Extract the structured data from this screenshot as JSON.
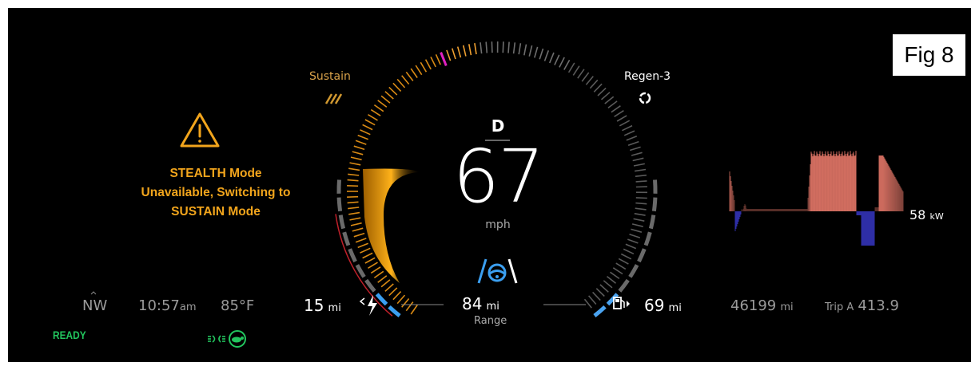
{
  "figure_label": "Fig 8",
  "mode_left": {
    "label": "Sustain"
  },
  "mode_right": {
    "label": "Regen-3"
  },
  "warning": {
    "line1": "STEALTH Mode",
    "line2": "Unavailable, Switching to",
    "line3": "SUSTAIN Mode"
  },
  "gear": "D",
  "speed": {
    "value": "67",
    "unit": "mph"
  },
  "power": {
    "value": "58",
    "unit": "kW"
  },
  "bottom": {
    "heading": "NW",
    "time": "10:57",
    "time_suffix": "am",
    "temperature": "85°F",
    "electric_range": "15",
    "electric_unit": "mi",
    "total_range": "84",
    "total_unit": "mi",
    "range_label": "Range",
    "fuel_range": "69",
    "fuel_unit": "mi",
    "odometer": "46199",
    "odometer_unit": "mi",
    "trip_label": "Trip A",
    "trip_value": "413.9"
  },
  "status": {
    "ready": "READY"
  },
  "colors": {
    "warning": "#f2a51c",
    "ready": "#22c55e",
    "lane_blue": "#3b9ff0",
    "gauge_orange": "#d98a14",
    "regen_blue": "#4aa3f0",
    "needle_magenta": "#e020c0"
  }
}
